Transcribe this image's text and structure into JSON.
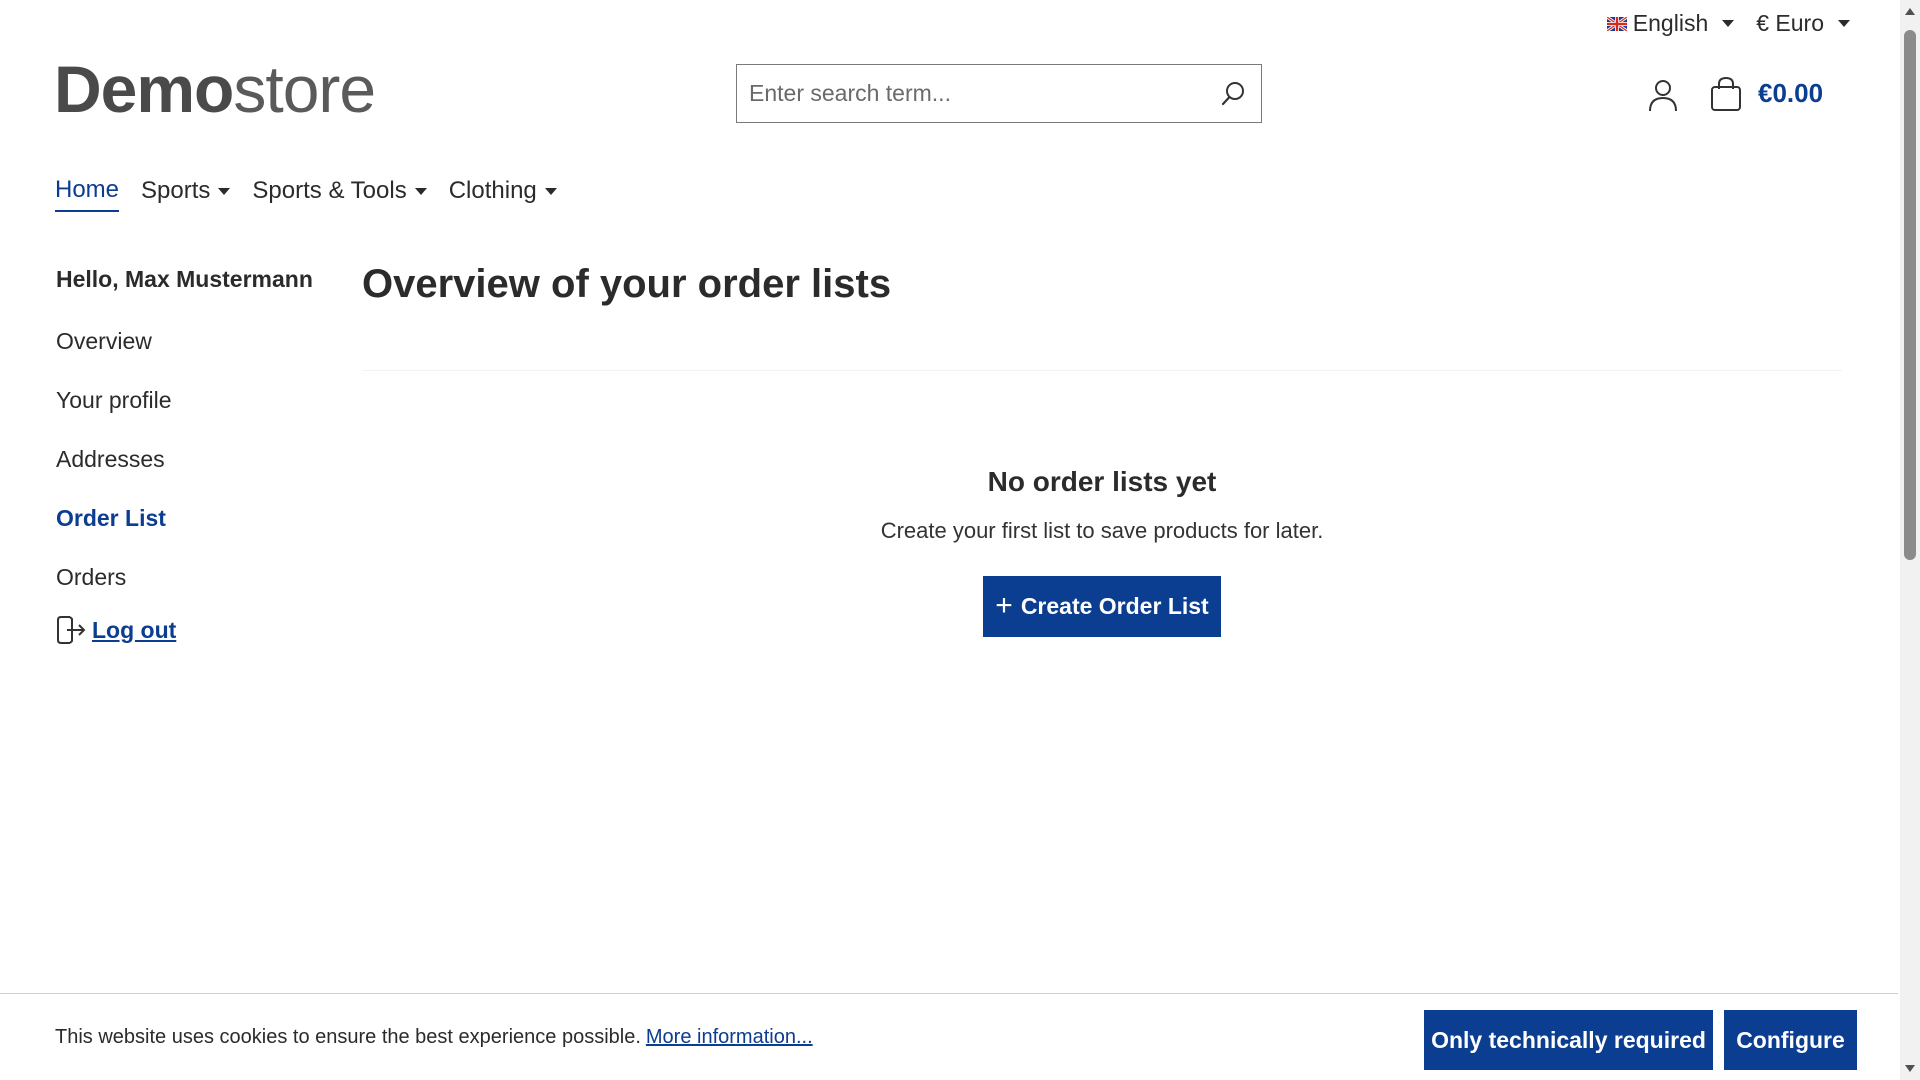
{
  "topbar": {
    "language": "English",
    "currency": "€ Euro"
  },
  "header": {
    "logo_bold": "Demo",
    "logo_light": "store",
    "search_placeholder": "Enter search term...",
    "cart_total": "€0.00"
  },
  "nav": {
    "items": [
      "Home",
      "Sports",
      "Sports & Tools",
      "Clothing"
    ]
  },
  "sidebar": {
    "greeting": "Hello, Max Mustermann",
    "links": [
      "Overview",
      "Your profile",
      "Addresses",
      "Order List",
      "Orders"
    ],
    "logout": "Log out"
  },
  "main": {
    "title": "Overview of your order lists",
    "empty_title": "No order lists yet",
    "empty_text": "Create your first list to save products for later.",
    "create_button": "Create Order List"
  },
  "cookie": {
    "message": "This website uses cookies to ensure the best experience possible.",
    "link": "More information...",
    "tech_button": "Only technically required",
    "configure_button": "Configure"
  },
  "colors": {
    "primary": "#0b3d91",
    "text": "#2b2b2b"
  }
}
